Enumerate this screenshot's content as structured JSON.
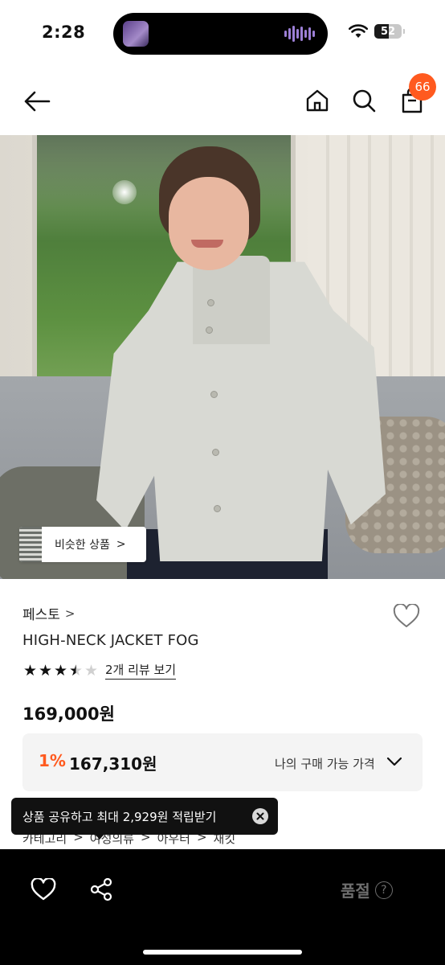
{
  "status_bar": {
    "time": "2:28",
    "battery": "52",
    "icons": [
      "now-playing-icon",
      "waveform-icon",
      "wifi-icon",
      "battery-icon"
    ]
  },
  "nav": {
    "icons": [
      "back-arrow-icon",
      "home-icon",
      "search-icon",
      "shopping-bag-icon"
    ],
    "cart_count": "66",
    "badge_color": "#ff5a1f"
  },
  "image": {
    "similar_button_label": "비슷한 상품"
  },
  "product": {
    "brand": "페스토",
    "title": "HIGH-NECK JACKET FOG",
    "rating": 3.5,
    "rating_max": 5,
    "review_link": "2개 리뷰 보기",
    "price": "169,000원"
  },
  "discount": {
    "rate": "1%",
    "price": "167,310원",
    "label": "나의 구매 가능 가격",
    "accent_color": "#ff5a1f"
  },
  "category": {
    "items": [
      "카테고리",
      "여성의류",
      "아우터",
      "재킷"
    ]
  },
  "toast": {
    "text": "상품 공유하고 최대 2,929원 적립받기"
  },
  "bottom_bar": {
    "soldout_label": "품절",
    "help_glyph": "?",
    "icons": [
      "heart-icon",
      "share-icon",
      "help-icon"
    ]
  }
}
